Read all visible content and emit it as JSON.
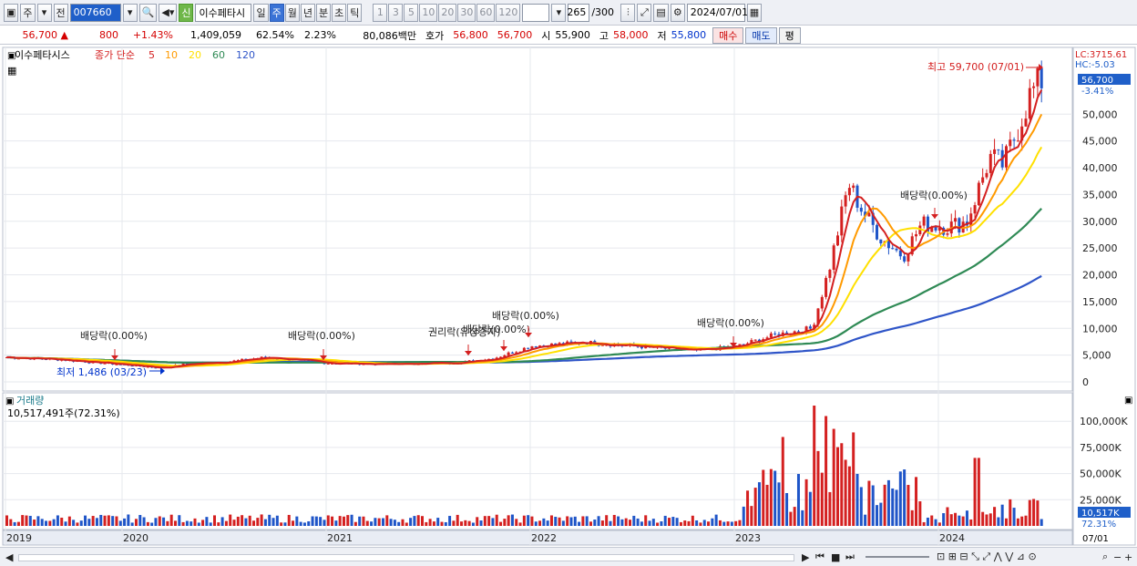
{
  "toolbar": {
    "mode_label": "주",
    "prev_label": "전",
    "code": "007660",
    "new_badge": "신",
    "name": "이수페타시",
    "periods": [
      "일",
      "주",
      "월",
      "년",
      "분",
      "초",
      "틱"
    ],
    "active_period": "주",
    "intervals": [
      "1",
      "3",
      "5",
      "10",
      "20",
      "30",
      "60",
      "120"
    ],
    "count": "265",
    "count_total": "/300",
    "date": "2024/07/01"
  },
  "quote": {
    "price": "56,700",
    "up_arrow": "▲",
    "change": "800",
    "change_pct": "+1.43%",
    "volume": "1,409,059",
    "volume_ratio": "62.54%",
    "turnover": "2.23%",
    "amount": "80,086백만",
    "bid_label": "호가",
    "bid1": "56,800",
    "bid2": "56,700",
    "open_label": "시",
    "open": "55,900",
    "high_label": "고",
    "high": "58,000",
    "low_label": "저",
    "low": "55,800",
    "buy_label": "매수",
    "sell_label": "매도",
    "eval_label": "평"
  },
  "chart": {
    "legend_name": "이수페타시스",
    "legend_ma": "종가 단순",
    "ma_periods": [
      {
        "label": "5",
        "color": "#d42020"
      },
      {
        "label": "10",
        "color": "#ff9a00"
      },
      {
        "label": "20",
        "color": "#ffe000"
      },
      {
        "label": "60",
        "color": "#2f8a55"
      },
      {
        "label": "120",
        "color": "#2f55c8"
      }
    ],
    "lc_label": "LC:3715.61",
    "hc_label": "HC:-5.03",
    "price_tag": "56,700",
    "price_tag_pct": "-3.41%",
    "high_note": "최고 59,700 (07/01)",
    "low_note": "최저 1,486 (03/23)",
    "y_ticks": [
      "50,000",
      "45,000",
      "40,000",
      "35,000",
      "30,000",
      "25,000",
      "20,000",
      "15,000",
      "10,000",
      "5,000",
      "0"
    ],
    "events": [
      {
        "label": "배당락(0.00%)"
      },
      {
        "label": "배당락(0.00%)"
      },
      {
        "label": "권리락(유상증자)"
      },
      {
        "label": "배당락(0.00%)"
      },
      {
        "label": "배당락(0.00%)"
      },
      {
        "label": "배당락(0.00%)"
      },
      {
        "label": "배당락(0.00%)"
      }
    ],
    "volume_title": "거래량",
    "volume_info": "10,517,491주(72.31%)",
    "vol_ticks": [
      "100,000K",
      "75,000K",
      "50,000K",
      "25,000K"
    ],
    "vol_tag": "10,517K",
    "vol_tag_pct": "72.31%",
    "x_labels": [
      "2019",
      "2020",
      "2021",
      "2022",
      "2023",
      "2024"
    ],
    "x_right_label": "07/01"
  },
  "chart_data": {
    "type": "candlestick",
    "title": "이수페타시스",
    "x": [
      "2019",
      "2020",
      "2021",
      "2022",
      "2023",
      "2024",
      "07/01"
    ],
    "ylim": [
      0,
      60000
    ],
    "close_series_approx": [
      4500,
      3000,
      3400,
      3800,
      6500,
      7200,
      6200,
      9000,
      35000,
      27000,
      30000,
      38000,
      56700
    ],
    "series": [
      {
        "name": "5",
        "values": [
          4600,
          3100,
          3500,
          3900,
          6700,
          7300,
          6300,
          9200,
          34000,
          27000,
          30000,
          40000,
          52000
        ]
      },
      {
        "name": "10",
        "values": [
          4500,
          3200,
          3500,
          3800,
          6400,
          7200,
          6300,
          8800,
          31000,
          28000,
          29500,
          38000,
          49000
        ]
      },
      {
        "name": "20",
        "values": [
          4400,
          3400,
          3500,
          3700,
          6000,
          7000,
          6400,
          8000,
          26000,
          29000,
          29000,
          35000,
          43000
        ]
      },
      {
        "name": "60",
        "values": [
          4300,
          3800,
          3500,
          3600,
          4800,
          6000,
          6200,
          6600,
          12000,
          20000,
          25000,
          28000,
          33000
        ]
      },
      {
        "name": "120",
        "values": [
          4200,
          4000,
          3600,
          3500,
          3900,
          5000,
          5500,
          5600,
          7000,
          12000,
          15000,
          17000,
          20000
        ]
      }
    ],
    "volume_ylim": [
      0,
      120000
    ],
    "volume_peaks_k": [
      {
        "x": "2023",
        "v": 115000
      },
      {
        "x": "2023",
        "v": 105000
      },
      {
        "x": "2023",
        "v": 85000
      },
      {
        "x": "2024",
        "v": 65000
      }
    ]
  }
}
